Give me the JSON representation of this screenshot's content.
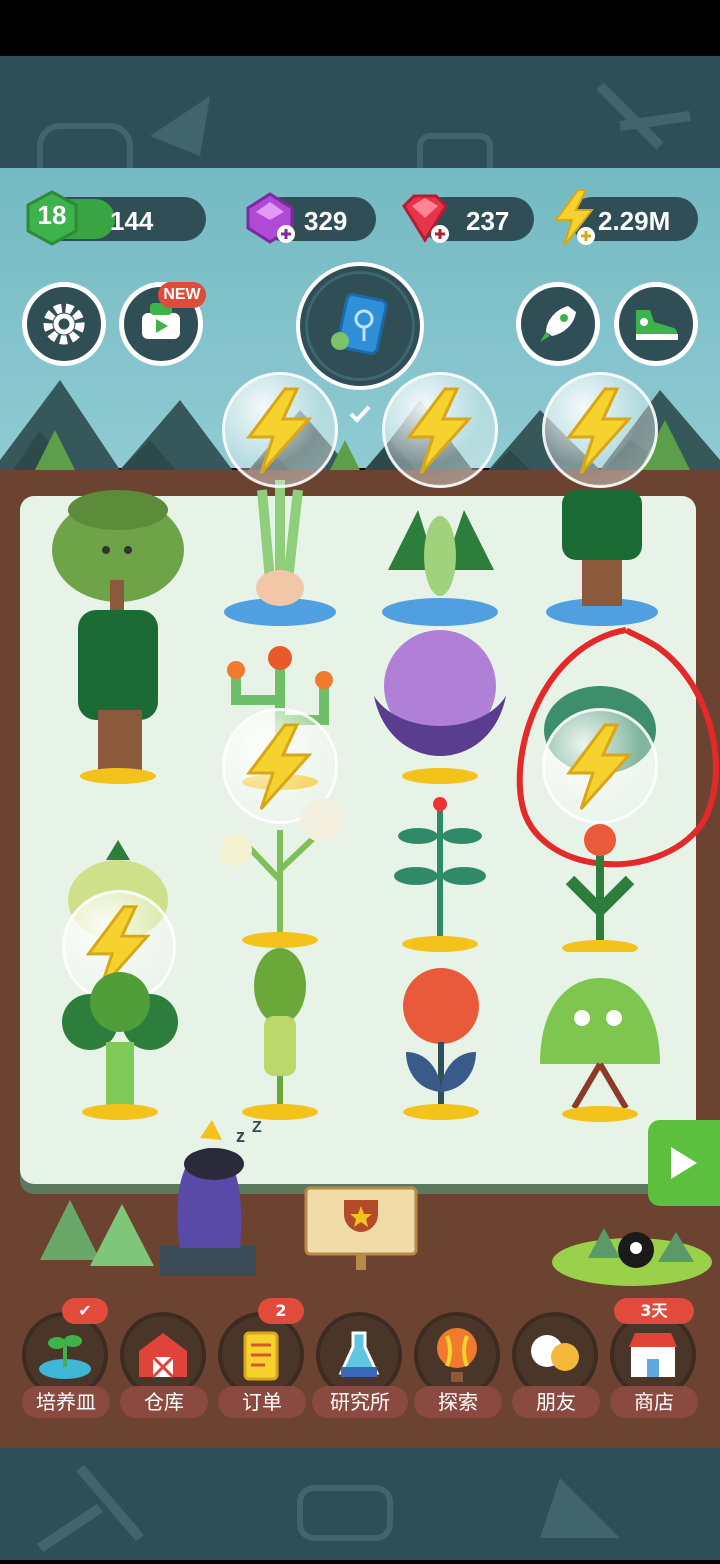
{
  "status": {
    "level": "18",
    "xp": "144",
    "gems": "329",
    "rubies": "237",
    "energy": "2.29M",
    "xp_progress": 0.45
  },
  "badges": {
    "new": "NEW"
  },
  "nav": {
    "items": [
      {
        "label": "培养皿",
        "badge": "✔"
      },
      {
        "label": "仓库",
        "badge": ""
      },
      {
        "label": "订单",
        "badge": "2"
      },
      {
        "label": "研究所",
        "badge": ""
      },
      {
        "label": "探索",
        "badge": ""
      },
      {
        "label": "朋友",
        "badge": ""
      },
      {
        "label": "商店",
        "badge": "3天"
      }
    ]
  },
  "colors": {
    "accent_green": "#3aa443",
    "panel": "#2f4e55",
    "nav_label": "#8a4a3f",
    "badge_red": "#e04b3c",
    "energy_yellow": "#f6d22f"
  },
  "icons": [
    "settings-gear-icon",
    "video-ad-icon",
    "book-icon",
    "rocket-icon",
    "sneaker-icon",
    "trophy-sign-icon",
    "play-arrow-icon"
  ]
}
